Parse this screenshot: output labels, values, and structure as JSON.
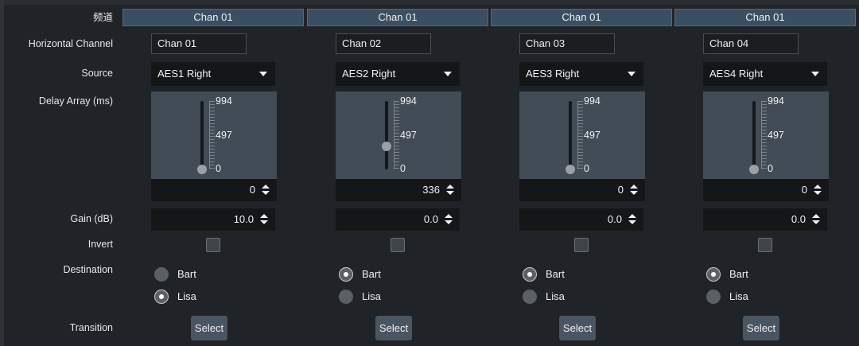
{
  "labels": {
    "channel_header": "频道",
    "horizontal_channel": "Horizontal Channel",
    "source": "Source",
    "delay_array": "Delay Array (ms)",
    "gain": "Gain (dB)",
    "invert": "Invert",
    "destination": "Destination",
    "transition": "Transition"
  },
  "scale": {
    "max": "994",
    "mid": "497",
    "min": "0"
  },
  "destination_options": [
    "Bart",
    "Lisa"
  ],
  "columns": [
    {
      "header": "Chan 01",
      "hc_value": "Chan 01",
      "source": "AES1 Right",
      "delay_value": "0",
      "delay_fraction": 0.0,
      "gain": "10.0",
      "invert": false,
      "destination": "Lisa",
      "transition_label": "Select"
    },
    {
      "header": "Chan 01",
      "hc_value": "Chan 02",
      "source": "AES2 Right",
      "delay_value": "336",
      "delay_fraction": 0.338,
      "gain": "0.0",
      "invert": false,
      "destination": "Bart",
      "transition_label": "Select"
    },
    {
      "header": "Chan 01",
      "hc_value": "Chan 03",
      "source": "AES3 Right",
      "delay_value": "0",
      "delay_fraction": 0.0,
      "gain": "0.0",
      "invert": false,
      "destination": "Bart",
      "transition_label": "Select"
    },
    {
      "header": "Chan 01",
      "hc_value": "Chan 04",
      "source": "AES4 Right",
      "delay_value": "0",
      "delay_fraction": 0.0,
      "gain": "0.0",
      "invert": false,
      "destination": "Bart",
      "transition_label": "Select"
    }
  ],
  "colors": {
    "background": "#202327",
    "header_bg": "#3b4f62",
    "field_bg": "#141618",
    "delay_panel": "#424c56",
    "button_bg": "#4a5562"
  }
}
